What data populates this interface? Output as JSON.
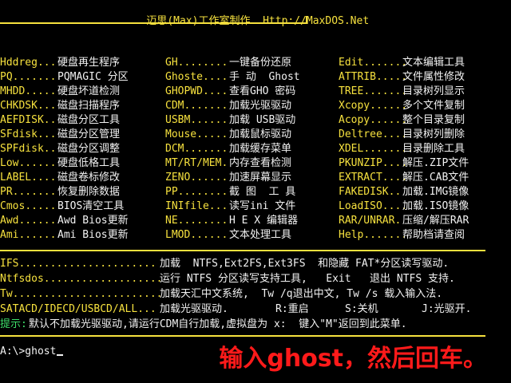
{
  "header": {
    "title": "迈思(Max)工作室制作",
    "url": "Http://MaxDOS.Net"
  },
  "menu": {
    "columns": [
      [
        {
          "key": "Hddreg",
          "dots": "...",
          "desc": "硬盘再生程序"
        },
        {
          "key": "PQ",
          "dots": ".......",
          "desc": "PQMAGIC 分区"
        },
        {
          "key": "MHDD",
          "dots": ".....",
          "desc": "硬盘坏道检测"
        },
        {
          "key": "CHKDSK",
          "dots": "...",
          "desc": "磁盘扫描程序"
        },
        {
          "key": "AEFDISK",
          "dots": "..",
          "desc": "磁盘分区工具"
        },
        {
          "key": "SFdisk",
          "dots": "...",
          "desc": "磁盘分区管理"
        },
        {
          "key": "SPFdisk",
          "dots": "..",
          "desc": "磁盘分区调整"
        },
        {
          "key": "Low",
          "dots": "......",
          "desc": "硬盘低格工具"
        },
        {
          "key": "LABEL",
          "dots": "....",
          "desc": "磁盘卷标修改"
        },
        {
          "key": "PR",
          "dots": ".......",
          "desc": "恢复删除数据"
        },
        {
          "key": "Cmos",
          "dots": ".....",
          "desc": "BIOS清空工具"
        },
        {
          "key": "Awd",
          "dots": "......",
          "desc": "Awd Bios更新"
        },
        {
          "key": "Ami",
          "dots": "......",
          "desc": "Ami Bios更新"
        }
      ],
      [
        {
          "key": "GH",
          "dots": "........",
          "desc": "一键备份还原"
        },
        {
          "key": "Ghoste",
          "dots": "....",
          "desc": "手 动  Ghost"
        },
        {
          "key": "GHOPWD",
          "dots": "....",
          "desc": "查看GHO 密码"
        },
        {
          "key": "CDM",
          "dots": ".......",
          "desc": "加载光驱驱动"
        },
        {
          "key": "USBM",
          "dots": "......",
          "desc": "加载 USB驱动"
        },
        {
          "key": "Mouse",
          "dots": ".....",
          "desc": "加载鼠标驱动"
        },
        {
          "key": "DCM",
          "dots": ".......",
          "desc": "加载缓存菜单"
        },
        {
          "key": "MT/RT/MEM",
          "dots": ".",
          "desc": "内存查看检测"
        },
        {
          "key": "ZENO",
          "dots": "......",
          "desc": "加速屏幕显示"
        },
        {
          "key": "PP",
          "dots": "........",
          "desc": "截 图  工 具"
        },
        {
          "key": "INIfile",
          "dots": "...",
          "desc": "读写ini 文件"
        },
        {
          "key": "NE",
          "dots": "........",
          "desc": "H E X 编辑器"
        },
        {
          "key": "LMOD",
          "dots": "......",
          "desc": "文本处理工具"
        }
      ],
      [
        {
          "key": "Edit",
          "dots": ".......",
          "desc": "文本编辑工具"
        },
        {
          "key": "ATTRIB",
          "dots": ".....",
          "desc": "文件属性修改"
        },
        {
          "key": "TREE",
          "dots": ".......",
          "desc": "目录树列显示"
        },
        {
          "key": "Xcopy",
          "dots": "......",
          "desc": "多个文件复制"
        },
        {
          "key": "Acopy",
          "dots": "......",
          "desc": "整个目录复制"
        },
        {
          "key": "Deltree",
          "dots": "....",
          "desc": "目录树列删除"
        },
        {
          "key": "XDEL",
          "dots": "........",
          "desc": "目录删除工具"
        },
        {
          "key": "PKUNZIP",
          "dots": "....",
          "desc": "解压.ZIP文件"
        },
        {
          "key": "EXTRACT",
          "dots": "....",
          "desc": "解压.CAB文件"
        },
        {
          "key": "FAKEDISK",
          "dots": "..",
          "desc": "加载.IMG镜像"
        },
        {
          "key": "LoadISO",
          "dots": "....",
          "desc": "加载.ISO镜像"
        },
        {
          "key": "RAR/UNRAR",
          "dots": ".",
          "desc": "压缩/解压RAR"
        },
        {
          "key": "Help",
          "dots": ".......",
          "desc": "帮助档请查阅"
        }
      ]
    ]
  },
  "lower": {
    "ifs": {
      "key": "IFS",
      "dots": "......................",
      "desc": "加载  NTFS,Ext2FS,Ext3FS  和隐藏 FAT*分区读写驱动."
    },
    "ntfsdos": {
      "key": "Ntfsdos",
      "dots": "...................",
      "desc": "运行 NTFS 分区读写支持工具,   Exit   退出 NTFS 支持."
    },
    "tw": {
      "key": "Tw",
      "dots": "........................",
      "desc": "加载天汇中文系统,  Tw /q退出中文, Tw /s 载入输入法."
    },
    "satacd": {
      "key": "SATACD/IDECD/USBCD/ALL",
      "dots": "...",
      "desc": "加载光驱驱动.",
      "r": "R:重启",
      "s": "S:关机",
      "j": "J:光驱开."
    },
    "tip_label": "提示:",
    "tip_text": "默认不加载光驱驱动,请运行CDM自行加载,虚拟盘为 x:  键入\"M\"返回到此菜单."
  },
  "prompt": {
    "text": "A:\\>ghost"
  },
  "overlay": {
    "text": "输入ghost，然后回车。"
  },
  "colors": {
    "key": "#f6e13e",
    "text": "#f2f2f2",
    "tip": "#3ee06a",
    "overlay": "#ff1a1a",
    "background": "#000000"
  }
}
